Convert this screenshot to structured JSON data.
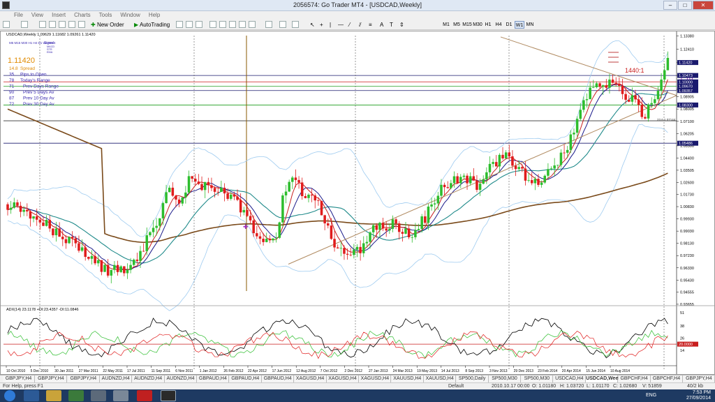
{
  "window": {
    "title": "2056574: Go Trader MT4 - [USDCAD,Weekly]"
  },
  "menu": [
    "File",
    "View",
    "Insert",
    "Charts",
    "Tools",
    "Window",
    "Help"
  ],
  "toolbar": {
    "new_order": "New Order",
    "autotrading": "AutoTrading",
    "timeframes": [
      "M1",
      "M5",
      "M15",
      "M30",
      "H1",
      "H4",
      "D1",
      "W1",
      "MN"
    ],
    "active_timeframe": "W1"
  },
  "chart": {
    "header": "USDCAD,Weekly  1.09629 1.11682 1.09261 1.11420",
    "signal_labels": {
      "timeframes": "M5  M15  M30  H1  H4  D1  W1  MN",
      "name": "Signals",
      "rows": [
        "MACD",
        "STR",
        "EMA"
      ]
    },
    "price_big": "1.11420",
    "info_rows": [
      {
        "value": "14.8",
        "label": "Spread",
        "color": "#e08a00"
      },
      {
        "value": "35",
        "label": "Pips to Open",
        "color": "#3a2ab0"
      },
      {
        "value": "78",
        "label": "Today's Range",
        "color": "#3a2ab0"
      },
      {
        "value": "71",
        "label": "Prev Days Range",
        "color": "#3a2ab0"
      },
      {
        "value": "90",
        "label": "Prev 5 Days Av",
        "color": "#3a2ab0"
      },
      {
        "value": "87",
        "label": "Prev 10 Day Av",
        "color": "#3a2ab0"
      },
      {
        "value": "72",
        "label": "Prev 30 Day Av",
        "color": "#3a2ab0"
      }
    ],
    "annotations": {
      "right_label": "1440:1",
      "level_label": "1.10",
      "fib_label": "23.6  1.07144"
    },
    "price_axis": [
      "1.13380",
      "1.12410",
      "1.11420",
      "1.10465",
      "1.09450",
      "1.08905",
      "1.08005",
      "1.07100",
      "1.06205",
      "1.05300",
      "1.04400",
      "1.03505",
      "1.02600",
      "1.01730",
      "1.00830",
      "0.99930",
      "0.99030",
      "0.98130",
      "0.97230",
      "0.96330",
      "0.95430",
      "0.94555",
      "0.93655"
    ],
    "price_tags": [
      {
        "text": "1.11420",
        "color": "#1a1a6e"
      },
      {
        "text": "1.10473",
        "color": "#1a1a6e"
      },
      {
        "text": "1.10000",
        "color": "#1a1a6e"
      },
      {
        "text": "1.09670",
        "color": "#1a1a6e"
      },
      {
        "text": "1.09357",
        "color": "#1a1a6e"
      },
      {
        "text": "1.08300",
        "color": "#1a1a6e"
      },
      {
        "text": "1.05486",
        "color": "#1a1a6e"
      }
    ],
    "date_axis": [
      "10 Oct 2010",
      "5 Dec 2010",
      "30 Jan 2011",
      "27 Mar 2011",
      "22 May 2011",
      "17 Jul 2011",
      "11 Sep 2011",
      "6 Nov 2011",
      "1 Jan 2012",
      "26 Feb 2012",
      "22 Apr 2012",
      "17 Jun 2012",
      "12 Aug 2012",
      "7 Oct 2012",
      "2 Dec 2012",
      "27 Jan 2013",
      "24 Mar 2013",
      "19 May 2013",
      "14 Jul 2013",
      "8 Sep 2013",
      "3 Nov 2013",
      "29 Dec 2013",
      "23 Feb 2014",
      "20 Apr 2014",
      "15 Jun 2014",
      "10 Aug 2014"
    ],
    "adx_header": "ADX(14) 23.1178 +DI:23.4357 -DI:11.0846",
    "adx_axis": [
      "51",
      "38",
      "26",
      "14"
    ],
    "adx_level": "20.0000"
  },
  "chart_data": {
    "type": "candlestick",
    "ylim": [
      0.936,
      1.134
    ],
    "ohlc": [],
    "adx_ylim": [
      5,
      55
    ]
  },
  "tabs": [
    {
      "label": "GBPJPY,H4"
    },
    {
      "label": "GBPJPY,H4"
    },
    {
      "label": "GBPJPY,H4"
    },
    {
      "label": "AUDNZD,H4"
    },
    {
      "label": "AUDNZD,H4"
    },
    {
      "label": "AUDNZD,H4"
    },
    {
      "label": "GBPAUD,H4"
    },
    {
      "label": "GBPAUD,H4"
    },
    {
      "label": "GBPAUD,H4"
    },
    {
      "label": "XAGUSD,H4"
    },
    {
      "label": "XAGUSD,H4"
    },
    {
      "label": "XAGUSD,H4"
    },
    {
      "label": "XAUUSD,H4"
    },
    {
      "label": "XAUUSD,H4"
    },
    {
      "label": "SP500,Daily"
    },
    {
      "label": "SP500,M30"
    },
    {
      "label": "SP500,M30"
    },
    {
      "label": "USDCAD,H4"
    },
    {
      "label": "USDCAD,Weekly",
      "active": true
    },
    {
      "label": "GBPCHF,H4"
    },
    {
      "label": "GBPCHF,H4"
    },
    {
      "label": "GBPJPY,H4"
    }
  ],
  "status": {
    "help": "For Help, press F1",
    "profile": "Default",
    "bar": "2010.10.17 00:00",
    "open": "O: 1.01180",
    "high": "H: 1.03720",
    "low": "L: 1.01170",
    "close": "C: 1.02680",
    "volume": "V: 51859",
    "traffic": "40/2 kb"
  },
  "taskbar": {
    "time": "7:53 PM",
    "date": "27/09/2014",
    "lang": "ENG"
  }
}
